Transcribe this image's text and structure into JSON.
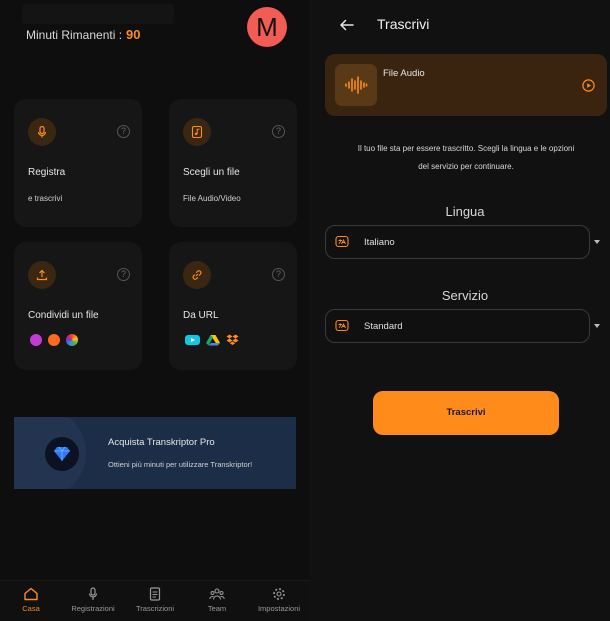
{
  "home": {
    "minutes_label": "Minuti Rimanenti :",
    "minutes_value": "90",
    "avatar_initial": "M",
    "cards": {
      "record": {
        "title": "Registra",
        "subtitle": "e trascrivi",
        "icon": "microphone-icon"
      },
      "choose_file": {
        "title": "Scegli un file",
        "subtitle": "File Audio/Video",
        "icon": "music-file-icon"
      },
      "share": {
        "title": "Condividi un file",
        "icon": "upload-icon",
        "logos": [
          "whatsapp-logo",
          "telegram-logo",
          "photos-logo"
        ]
      },
      "url": {
        "title": "Da URL",
        "icon": "link-icon",
        "logos": [
          "youtube-logo",
          "google-drive-logo",
          "dropbox-logo"
        ]
      }
    },
    "promo": {
      "title": "Acquista Transkriptor Pro",
      "subtitle": "Ottieni più minuti per utilizzare Transkriptor!"
    },
    "nav": [
      {
        "label": "Casa",
        "icon": "home-icon",
        "active": true
      },
      {
        "label": "Registrazioni",
        "icon": "microphone-icon",
        "active": false
      },
      {
        "label": "Trascrizioni",
        "icon": "document-icon",
        "active": false
      },
      {
        "label": "Team",
        "icon": "team-icon",
        "active": false
      },
      {
        "label": "Impostazioni",
        "icon": "gear-icon",
        "active": false
      }
    ]
  },
  "transcribe": {
    "title": "Trascrivi",
    "file_label": "File Audio",
    "description_line1": "Il tuo file sta per essere trascritto. Scegli la lingua e le opzioni",
    "description_line2": "del servizio per continuare.",
    "language_label": "Lingua",
    "language_value": "Italiano",
    "service_label": "Servizio",
    "service_value": "Standard",
    "submit_label": "Trascrivi"
  },
  "colors": {
    "accent": "#ff8c1a",
    "avatar": "#f25c54",
    "promo_bg": "#1c2e47",
    "background": "#0e0e0e"
  }
}
